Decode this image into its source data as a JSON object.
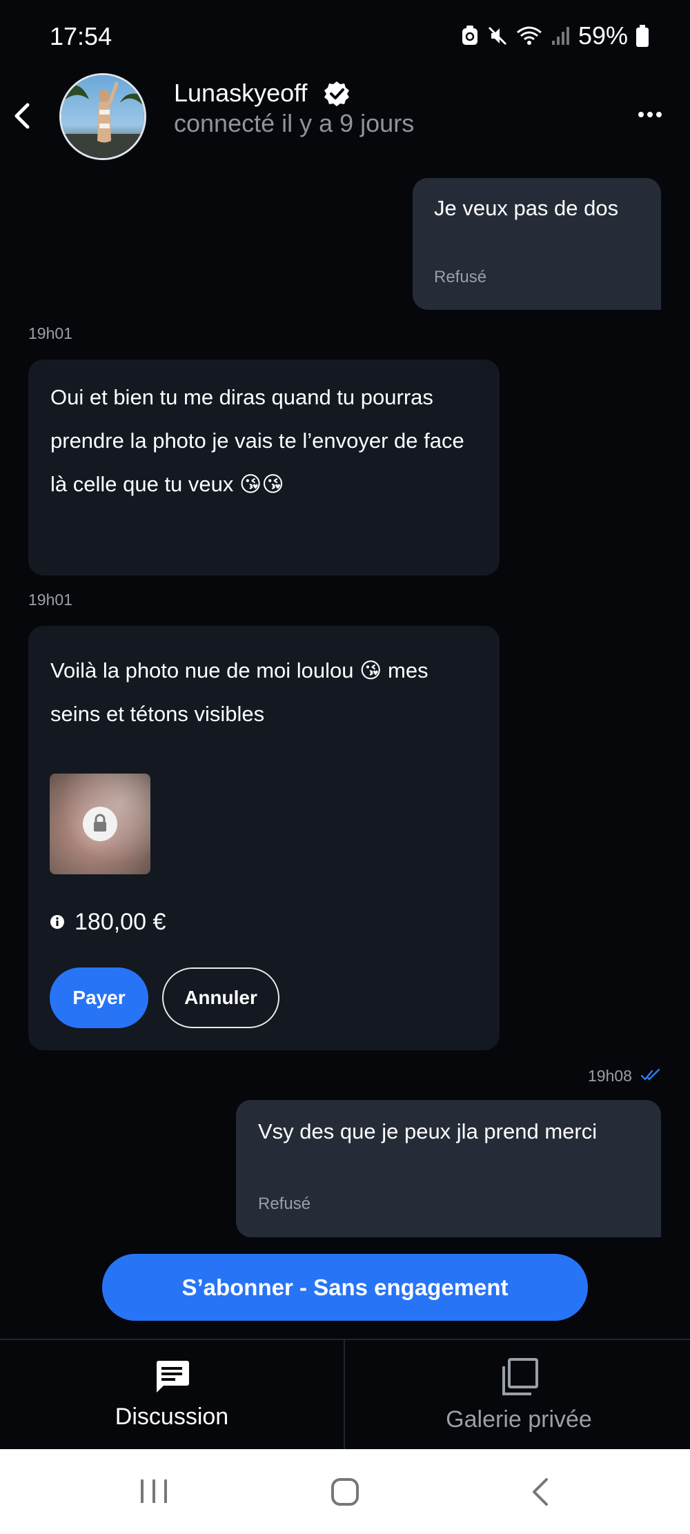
{
  "status_bar": {
    "time": "17:54",
    "battery": "59%"
  },
  "header": {
    "name": "Lunaskyeoff",
    "status": "connecté il y a 9 jours"
  },
  "messages": [
    {
      "direction": "out",
      "text": "Je veux pas de dos",
      "meta": "Refusé"
    },
    {
      "direction": "in",
      "time": "19h01",
      "text": "Oui et bien tu me diras quand tu pourras prendre la photo je vais te l’envoyer de face là celle que tu veux 😘😘"
    },
    {
      "direction": "in",
      "time": "19h01",
      "text": "Voilà la photo nue de moi loulou 😘 mes seins et tétons visibles",
      "price": "180,00 €",
      "pay_label": "Payer",
      "cancel_label": "Annuler"
    },
    {
      "direction": "out",
      "time": "19h08",
      "text": "Vsy des que je peux jla prend merci",
      "meta": "Refusé"
    }
  ],
  "subscribe_label": "S’abonner - Sans engagement",
  "tabs": [
    {
      "label": "Discussion",
      "active": true
    },
    {
      "label": "Galerie privée",
      "active": false
    }
  ],
  "colors": {
    "accent": "#2774f6",
    "background": "#05070b",
    "bubble_in": "#131821",
    "bubble_out": "#262c37"
  }
}
